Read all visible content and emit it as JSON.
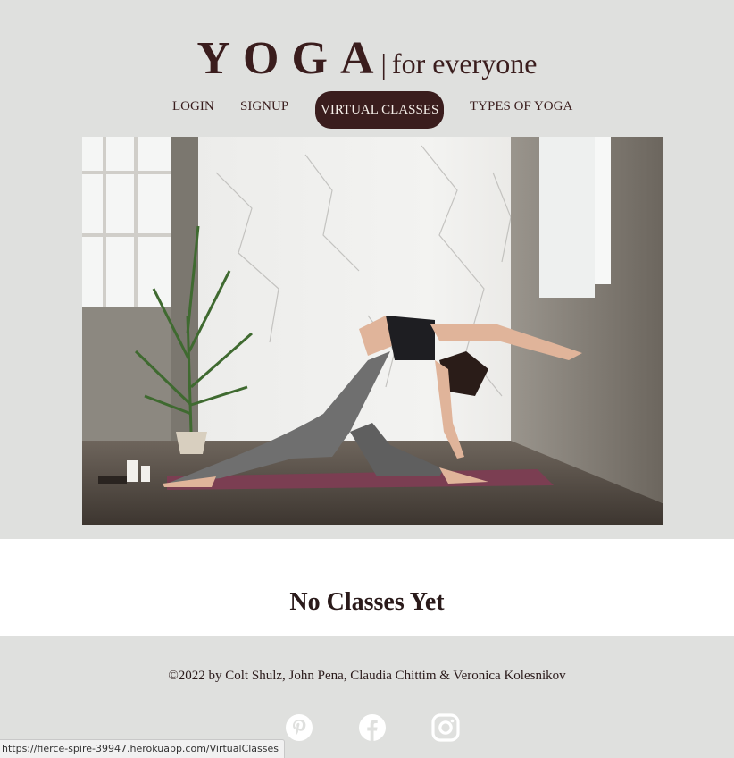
{
  "logo": {
    "main": "YOGA",
    "separator": "|",
    "tagline": "for everyone"
  },
  "nav": {
    "items": [
      {
        "label": "LOGIN"
      },
      {
        "label": "SIGNUP"
      },
      {
        "label": "VIRTUAL CLASSES",
        "active": true
      },
      {
        "label": "TYPES OF YOGA"
      }
    ]
  },
  "hero": {
    "alt_icon": "yoga-photo"
  },
  "main": {
    "heading": "No Classes Yet"
  },
  "footer": {
    "copyright": "©2022 by Colt Shulz, John Pena, Claudia Chittim & Veronica Kolesnikov",
    "social": [
      "pinterest-icon",
      "facebook-icon",
      "instagram-icon"
    ]
  },
  "status_bar": {
    "url": "https://fierce-spire-39947.herokuapp.com/VirtualClasses"
  },
  "colors": {
    "brand": "#3a1d1d",
    "background": "#dfe0de",
    "content": "#ffffff"
  }
}
